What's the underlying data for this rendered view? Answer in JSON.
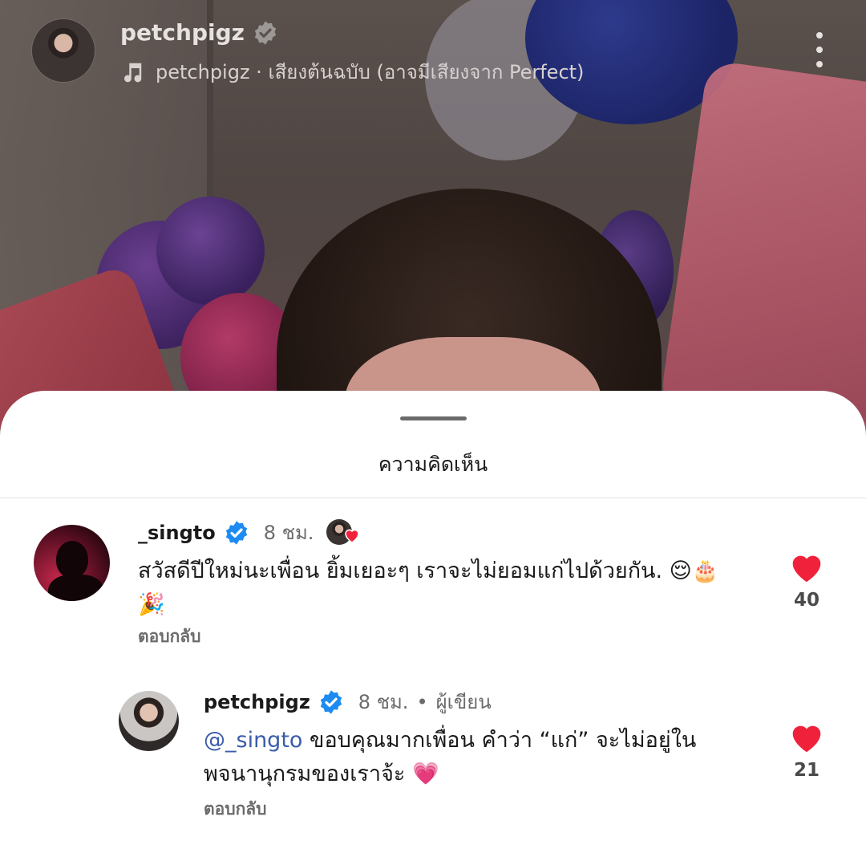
{
  "header": {
    "username": "petchpigz",
    "audio": "petchpigz · เสียงต้นฉบับ (อาจมีเสียงจาก Perfect)"
  },
  "sheet": {
    "title": "ความคิดเห็น"
  },
  "comments": [
    {
      "user": "_singto",
      "time": "8 ชม.",
      "text": "สวัสดีปีใหม่นะเพื่อน ยิ้มเยอะๆ เราจะไม่ยอมแก่ไปด้วยกัน. 😌🎂",
      "text2": "🎉",
      "reply_label": "ตอบกลับ",
      "likes": "40"
    },
    {
      "user": "petchpigz",
      "time": "8 ชม.",
      "author_label": "ผู้เขียน",
      "mention": "@_singto",
      "text": " ขอบคุณมากเพื่อน คำว่า “แก่” จะไม่อยู่ใน",
      "text2": "พจนานุกรมของเราจ้ะ 💗",
      "reply_label": "ตอบกลับ",
      "likes": "21"
    }
  ],
  "colors": {
    "verified": "#1d8bf1",
    "like": "#f0223b",
    "mention": "#3b5ca8"
  }
}
